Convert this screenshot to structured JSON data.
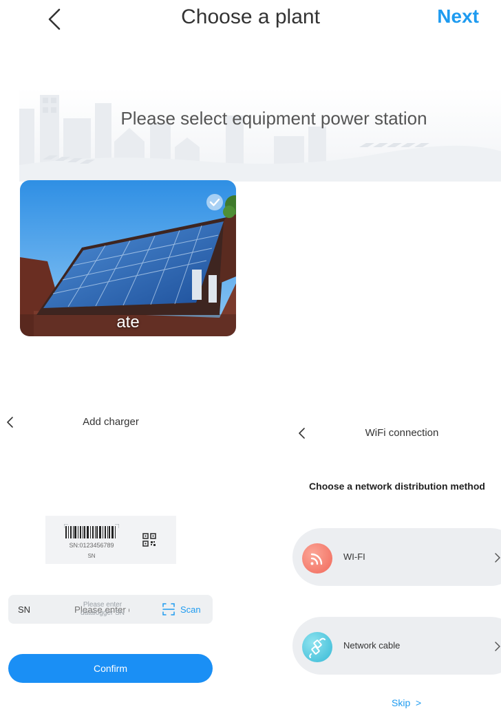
{
  "header": {
    "back_icon": "chevron-left-icon",
    "title": "Choose a plant",
    "next_label": "Next",
    "accent_color": "#1e9bf0"
  },
  "banner": {
    "text": "Please select equipment power station",
    "background_icon": "city-skyline-illustration"
  },
  "plants": [
    {
      "name": "ate",
      "selected": true,
      "image": "rooftop-solar-panels-photo",
      "check_icon": "check-circle-icon"
    }
  ],
  "add_charger": {
    "back_icon": "chevron-left-icon",
    "title": "Add charger",
    "sample_barcode_sn": "SN:0123456789",
    "sample_caption": "SN",
    "qr_icon": "qr-code-icon",
    "sn_field": {
      "label": "SN",
      "placeholder": "Please enter datalogger SN",
      "value": ""
    },
    "scan_label": "Scan",
    "scan_icon": "scan-frame-icon",
    "confirm_label": "Confirm",
    "button_color": "#1a8ff5"
  },
  "wifi_connection": {
    "back_icon": "chevron-left-icon",
    "title": "WiFi connection",
    "subtitle": "Choose a network distribution method",
    "methods": [
      {
        "label": "WI-FI",
        "icon": "wifi-signal-icon",
        "color": "#f47a6a"
      },
      {
        "label": "Network cable",
        "icon": "network-cable-icon",
        "color": "#4fc7de"
      }
    ],
    "skip_label": "Skip  >"
  }
}
